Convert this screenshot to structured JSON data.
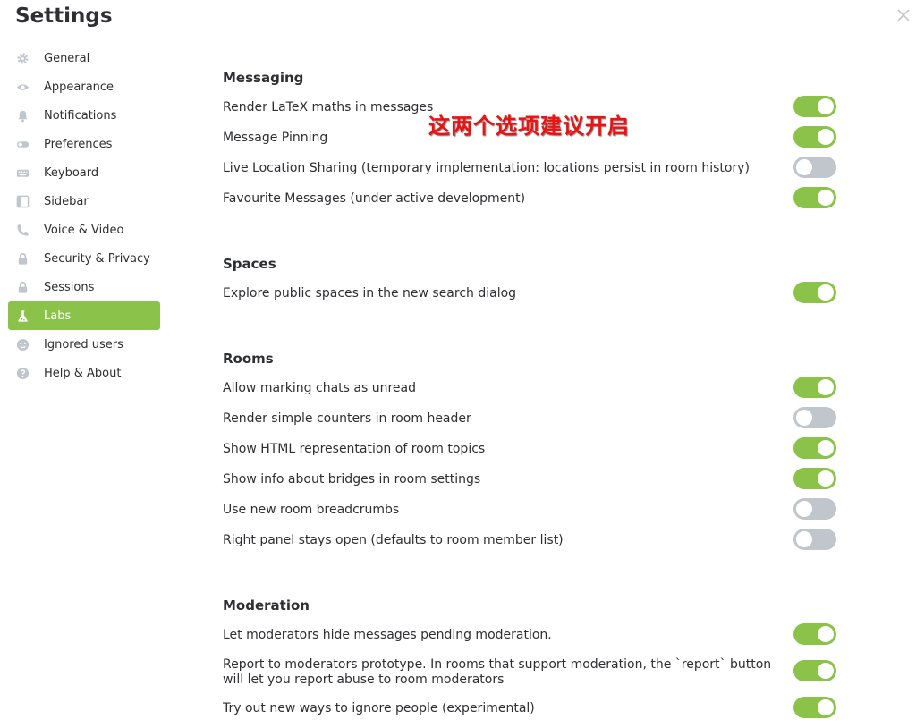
{
  "header": {
    "title": "Settings"
  },
  "sidebar": {
    "items": [
      {
        "label": "General",
        "icon": "gear-icon"
      },
      {
        "label": "Appearance",
        "icon": "eye-icon"
      },
      {
        "label": "Notifications",
        "icon": "bell-icon"
      },
      {
        "label": "Preferences",
        "icon": "toggle-icon"
      },
      {
        "label": "Keyboard",
        "icon": "keyboard-icon"
      },
      {
        "label": "Sidebar",
        "icon": "sidebar-icon"
      },
      {
        "label": "Voice & Video",
        "icon": "phone-icon"
      },
      {
        "label": "Security & Privacy",
        "icon": "lock-icon"
      },
      {
        "label": "Sessions",
        "icon": "lock-icon"
      },
      {
        "label": "Labs",
        "icon": "flask-icon",
        "active": true
      },
      {
        "label": "Ignored users",
        "icon": "face-icon"
      },
      {
        "label": "Help & About",
        "icon": "help-icon"
      }
    ]
  },
  "annotation": "这两个选项建议开启",
  "colors": {
    "accent": "#8bc34a",
    "toggle_off": "#c1c6cd",
    "annotation": "#ee1111"
  },
  "sections": [
    {
      "title": "Messaging",
      "rows": [
        {
          "label": "Render LaTeX maths in messages",
          "on": true
        },
        {
          "label": "Message Pinning",
          "on": true
        },
        {
          "label": "Live Location Sharing (temporary implementation: locations persist in room history)",
          "on": false
        },
        {
          "label": "Favourite Messages (under active development)",
          "on": true
        }
      ]
    },
    {
      "title": "Spaces",
      "rows": [
        {
          "label": "Explore public spaces in the new search dialog",
          "on": true
        }
      ]
    },
    {
      "title": "Rooms",
      "rows": [
        {
          "label": "Allow marking chats as unread",
          "on": true
        },
        {
          "label": "Render simple counters in room header",
          "on": false
        },
        {
          "label": "Show HTML representation of room topics",
          "on": true
        },
        {
          "label": "Show info about bridges in room settings",
          "on": true
        },
        {
          "label": "Use new room breadcrumbs",
          "on": false
        },
        {
          "label": "Right panel stays open (defaults to room member list)",
          "on": false
        }
      ]
    },
    {
      "title": "Moderation",
      "rows": [
        {
          "label": "Let moderators hide messages pending moderation.",
          "on": true
        },
        {
          "label": "Report to moderators prototype. In rooms that support moderation, the `report` button will let you report abuse to room moderators",
          "on": true
        },
        {
          "label": "Try out new ways to ignore people (experimental)",
          "on": true
        }
      ]
    }
  ]
}
